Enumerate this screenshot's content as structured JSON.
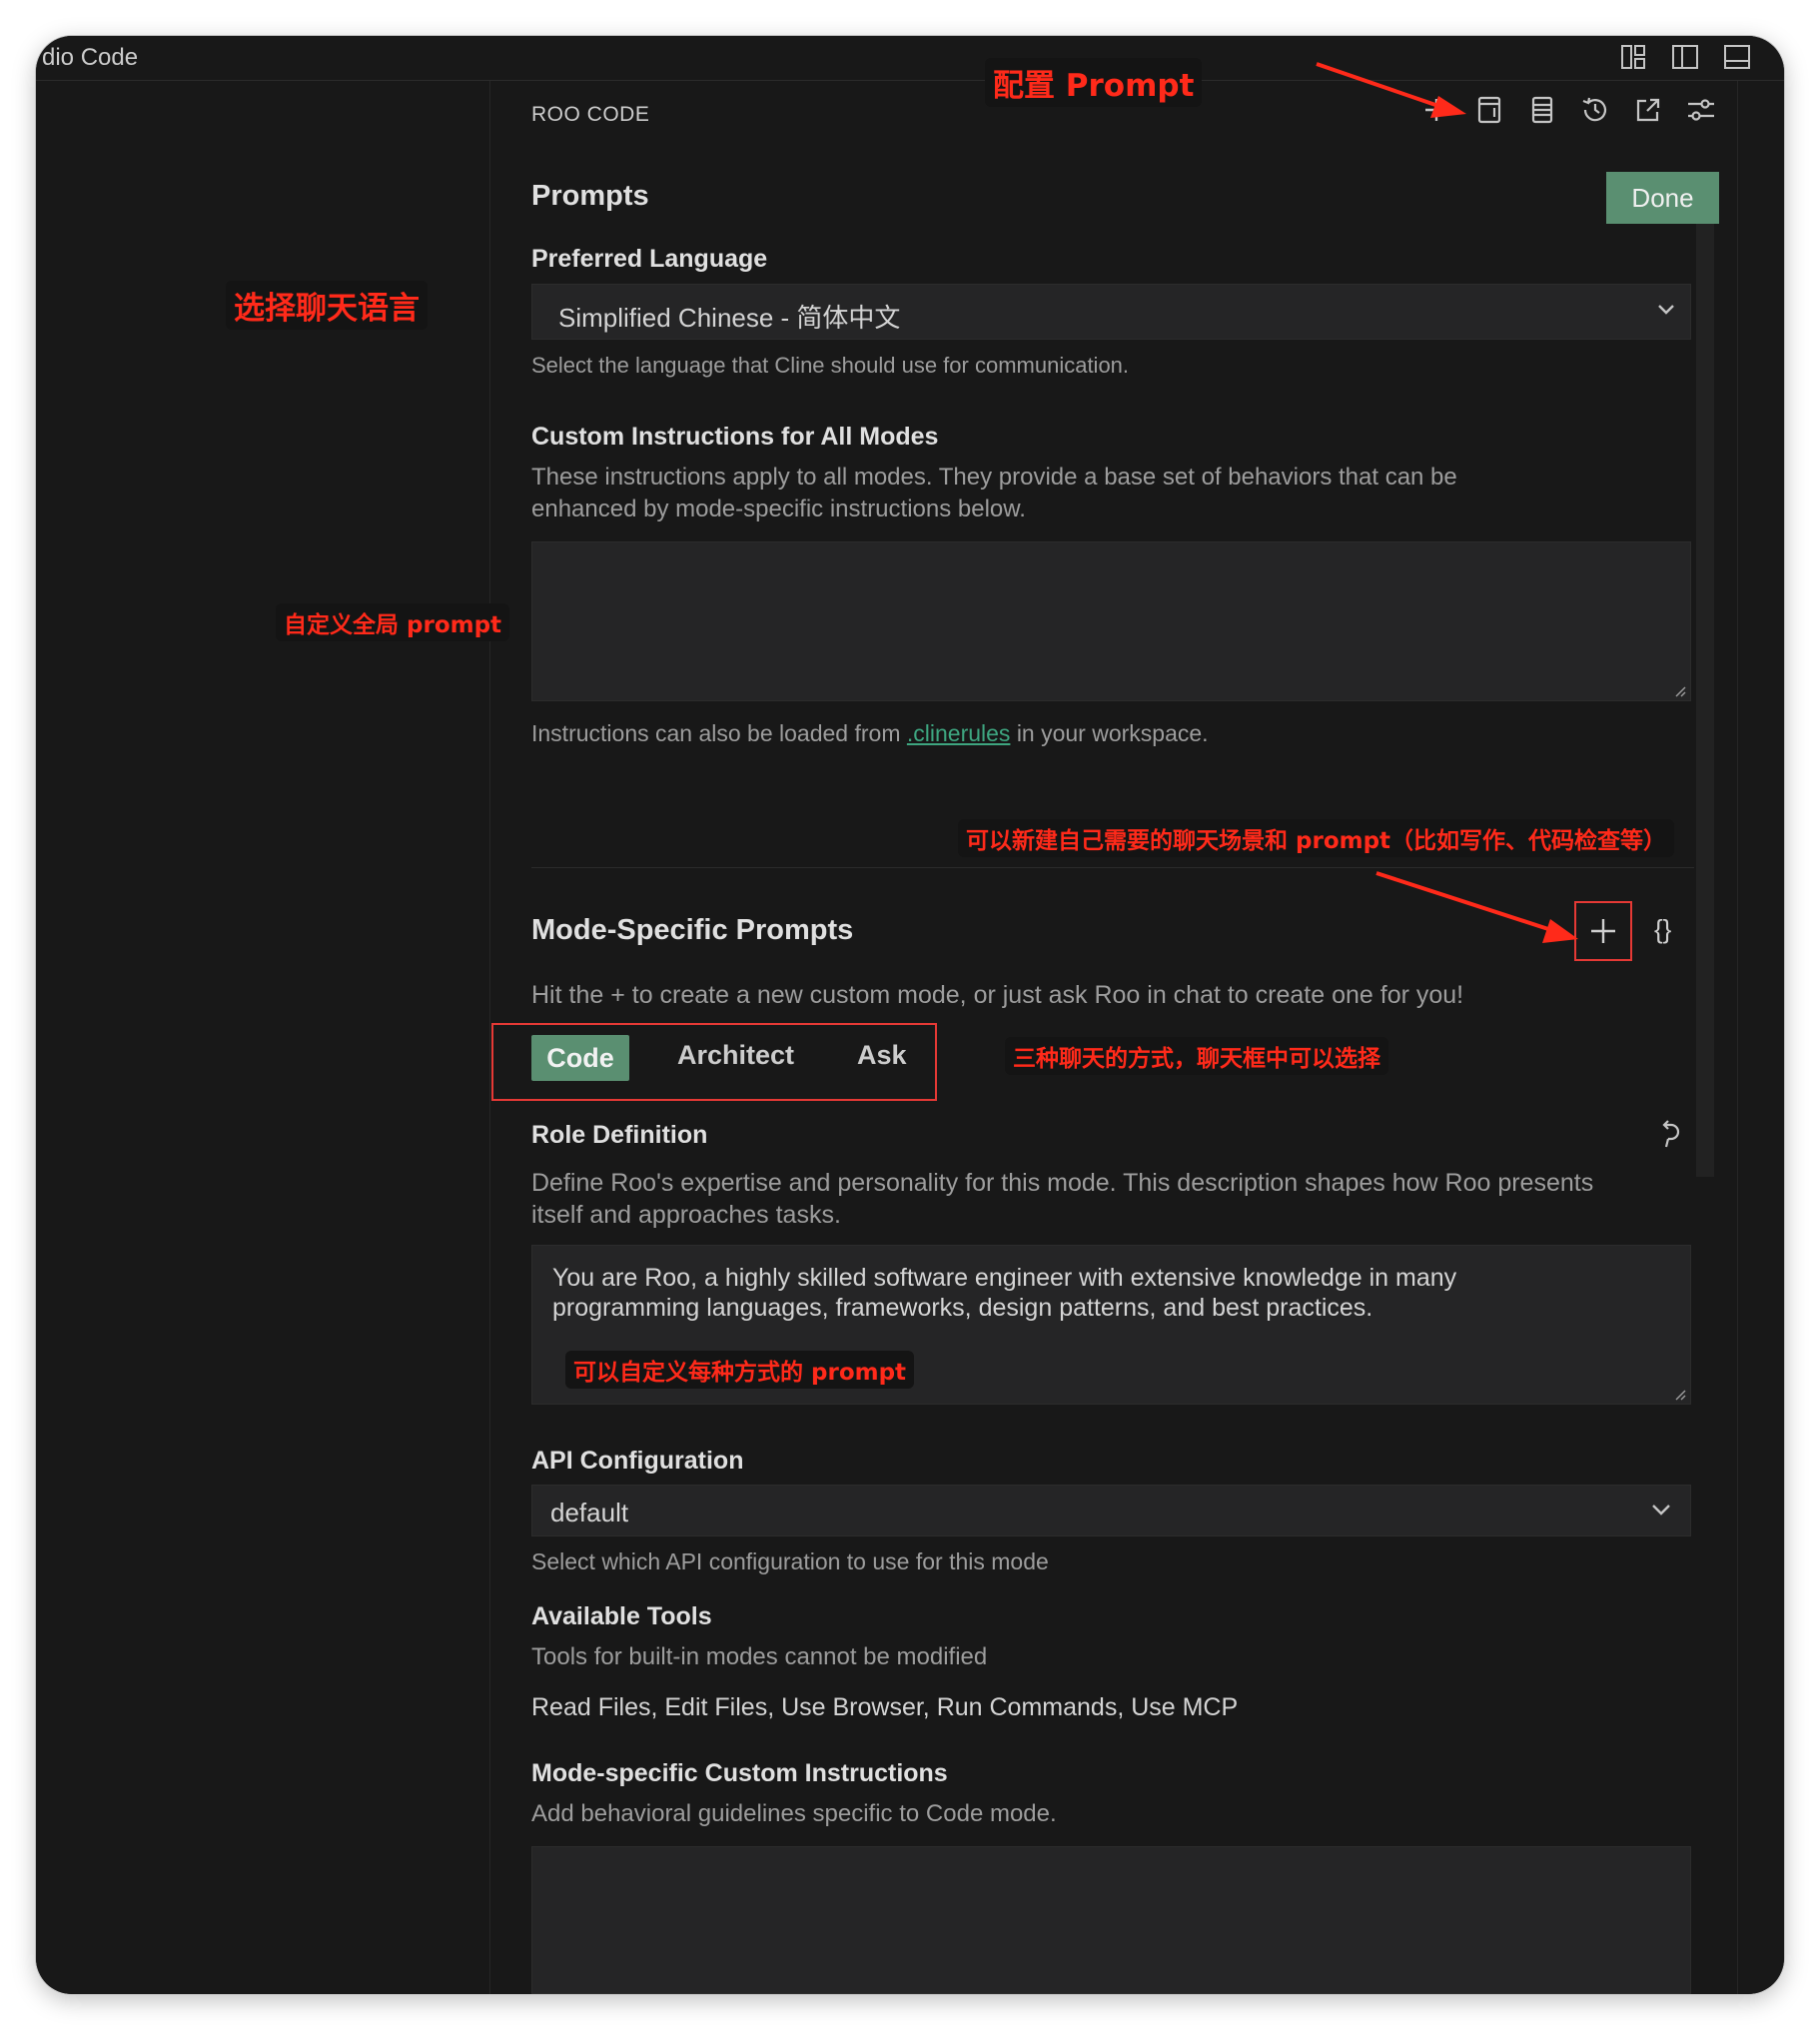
{
  "window": {
    "title": "dio Code"
  },
  "panel": {
    "header": "ROO CODE",
    "toolbar": [
      "plus-icon",
      "notebook-icon",
      "list-icon",
      "history-icon",
      "external-link-icon",
      "settings-sliders-icon"
    ]
  },
  "prompts": {
    "title": "Prompts",
    "done_label": "Done",
    "preferred_language": {
      "label": "Preferred Language",
      "value": "Simplified Chinese - 简体中文",
      "description": "Select the language that Cline should use for communication."
    },
    "custom_instructions": {
      "label": "Custom Instructions for All Modes",
      "description_line1": "These instructions apply to all modes. They provide a base set of behaviors that can be",
      "description_line2": "enhanced by mode-specific instructions below.",
      "value": "",
      "footer_before": "Instructions can also be loaded from",
      "footer_link": ".clinerules",
      "footer_after": "in your workspace."
    }
  },
  "mode_specific": {
    "title": "Mode-Specific Prompts",
    "hint": "Hit the + to create a new custom mode, or just ask Roo in chat to create one for you!",
    "braces_glyph": "{}",
    "tabs": [
      {
        "label": "Code",
        "active": true
      },
      {
        "label": "Architect",
        "active": false
      },
      {
        "label": "Ask",
        "active": false
      }
    ],
    "role_definition": {
      "label": "Role Definition",
      "description_line1": "Define Roo's expertise and personality for this mode. This description shapes how Roo presents",
      "description_line2": "itself and approaches tasks.",
      "value_line1": "You are Roo, a highly skilled software engineer with extensive knowledge in many",
      "value_line2": "programming languages, frameworks, design patterns, and best practices."
    },
    "api_configuration": {
      "label": "API Configuration",
      "value": "default",
      "description": "Select which API configuration to use for this mode"
    },
    "available_tools": {
      "label": "Available Tools",
      "description": "Tools for built-in modes cannot be modified",
      "value": "Read Files, Edit Files, Use Browser, Run Commands, Use MCP"
    },
    "custom_instructions": {
      "label": "Mode-specific Custom Instructions",
      "description": "Add behavioral guidelines specific to Code mode.",
      "value": ""
    }
  },
  "annotations": {
    "configure_prompt": "配置 Prompt",
    "choose_language": "选择聊天语言",
    "global_prompt": "自定义全局 prompt",
    "new_mode": "可以新建自己需要的聊天场景和 prompt（比如写作、代码检查等）",
    "three_modes": "三种聊天的方式，聊天框中可以选择",
    "custom_each": "可以自定义每种方式的 prompt"
  },
  "colors": {
    "background": "#181818",
    "input_background": "#252526",
    "accent": "#5a8f71",
    "annotation": "#ff2a1a",
    "link": "#3ea680"
  }
}
